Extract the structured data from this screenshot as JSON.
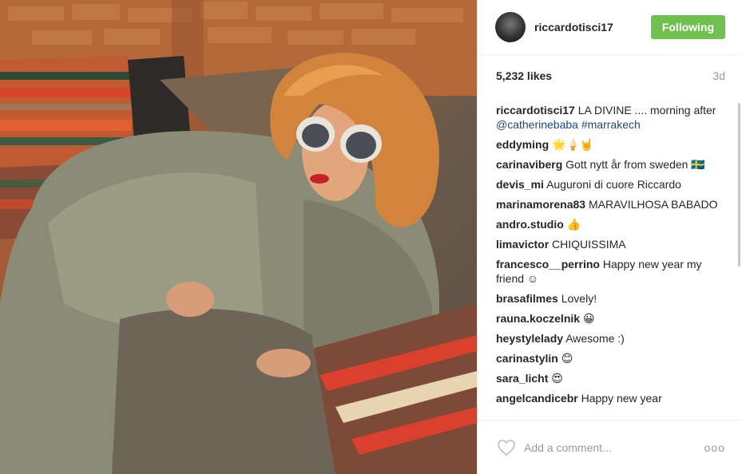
{
  "post": {
    "username": "riccardotisci17",
    "follow_label": "Following",
    "likes": "5,232 likes",
    "time": "3d"
  },
  "comments": [
    {
      "user": "riccardotisci17",
      "text": "LA DIVINE .... morning after ",
      "mention": "@catherinebaba",
      "hashtag": "#marrakech"
    },
    {
      "user": "eddyming",
      "text": "🌟🍦🤘"
    },
    {
      "user": "carinaviberg",
      "text": "Gott nytt år from sweden 🇸🇪"
    },
    {
      "user": "devis_mi",
      "text": "Auguroni di cuore Riccardo"
    },
    {
      "user": "marinamorena83",
      "text": "MARAVILHOSA BABADO"
    },
    {
      "user": "andro.studio",
      "text": "👍"
    },
    {
      "user": "limavictor",
      "text": "CHIQUISSIMA"
    },
    {
      "user": "francesco__perrino",
      "text": "Happy new year my friend ☺"
    },
    {
      "user": "brasafilmes",
      "text": "Lovely!"
    },
    {
      "user": "rauna.koczelnik",
      "text": "😀"
    },
    {
      "user": "heystylelady",
      "text": "Awesome :)"
    },
    {
      "user": "carinastylin",
      "text": "😊"
    },
    {
      "user": "sara_licht",
      "text": "😍"
    },
    {
      "user": "angelcandicebr",
      "text": "Happy new year"
    }
  ],
  "footer": {
    "placeholder": "Add a comment...",
    "more": "ooo"
  },
  "colors": {
    "follow_button": "#70c050",
    "link": "#1c4a77",
    "muted": "#999999"
  },
  "icons": {
    "heart": "heart-icon",
    "more": "more-options-icon"
  }
}
